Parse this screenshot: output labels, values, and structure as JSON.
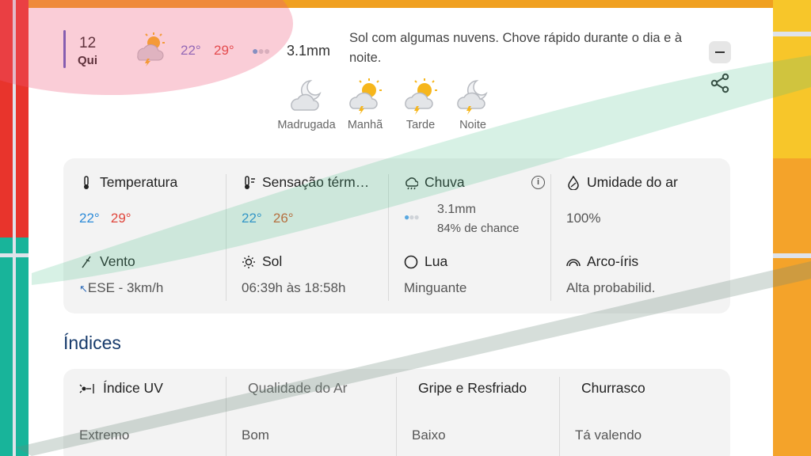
{
  "day": {
    "number": "12",
    "name": "Qui",
    "icon": "partly-sunny-storm-icon",
    "temp_min": "22°",
    "temp_max": "29°",
    "rain_mm": "3.1mm",
    "description": "Sol com algumas nuvens. Chove rápido durante o dia e à noite."
  },
  "periods": [
    {
      "label": "Madrugada",
      "icon": "cloud-moon-icon"
    },
    {
      "label": "Manhã",
      "icon": "sun-cloud-storm-icon"
    },
    {
      "label": "Tarde",
      "icon": "sun-cloud-storm-icon"
    },
    {
      "label": "Noite",
      "icon": "moon-cloud-storm-icon"
    }
  ],
  "details": {
    "temperatura": {
      "label": "Temperatura",
      "min": "22°",
      "max": "29°"
    },
    "sensacao": {
      "label": "Sensação térm…",
      "min": "22°",
      "max": "26°"
    },
    "chuva": {
      "label": "Chuva",
      "mm": "3.1mm",
      "chance": "84% de chance"
    },
    "umidade": {
      "label": "Umidade do ar",
      "value": "100%"
    },
    "vento": {
      "label": "Vento",
      "value": "ESE - 3km/h"
    },
    "sol": {
      "label": "Sol",
      "value": "06:39h às 18:58h"
    },
    "lua": {
      "label": "Lua",
      "value": "Minguante"
    },
    "arco": {
      "label": "Arco-íris",
      "value": "Alta probabilid."
    }
  },
  "indices": {
    "title": "Índices",
    "uv": {
      "label": "Índice UV",
      "value": "Extremo"
    },
    "ar": {
      "label": "Qualidade do Ar",
      "value": "Bom"
    },
    "gripe": {
      "label": "Gripe e Resfriado",
      "value": "Baixo"
    },
    "churrasco": {
      "label": "Churrasco",
      "value": "Tá valendo"
    }
  },
  "colors": {
    "accent_bar": "#5a5fc8",
    "temp_min_day": "#6d6fd0",
    "temp_max": "#e0463c",
    "temp_min": "#2d8bd8",
    "heading": "#163a6b"
  }
}
